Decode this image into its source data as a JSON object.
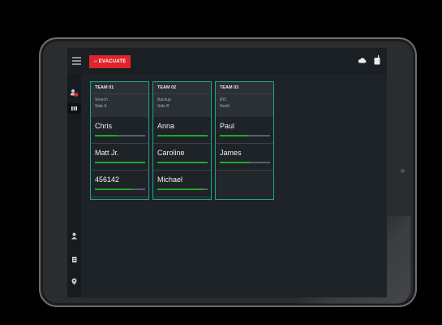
{
  "colors": {
    "accent_teal": "#1fa38a",
    "evacuate_red": "#e0242b",
    "progress_green": "#1cab2c",
    "screen_bg": "#1e2328"
  },
  "topbar": {
    "evacuate_label": "EVACUATE",
    "evacuate_prefix": "›‹",
    "menu_icon": "hamburger-icon",
    "cloud_icon": "cloud-icon",
    "radio_icon": "radio-icon"
  },
  "rail": {
    "items": [
      {
        "icon": "team-alert-icon"
      },
      {
        "icon": "columns-icon",
        "active": true
      },
      {
        "icon": "person-icon"
      },
      {
        "icon": "document-icon"
      },
      {
        "icon": "location-pin-icon"
      }
    ]
  },
  "teams": [
    {
      "name": "TEAM 01",
      "task": "Search",
      "area": "Side A",
      "members": [
        {
          "name": "Chris",
          "progress": 0.45
        },
        {
          "name": "Matt Jr.",
          "progress": 1.0
        },
        {
          "name": "456142",
          "progress": 0.72
        }
      ]
    },
    {
      "name": "TEAM 02",
      "task": "Backup",
      "area": "Side B",
      "members": [
        {
          "name": "Anna",
          "progress": 1.0
        },
        {
          "name": "Caroline",
          "progress": 1.0
        },
        {
          "name": "Michael",
          "progress": 0.9
        }
      ]
    },
    {
      "name": "TEAM 03",
      "task": "RIC",
      "area": "North",
      "members": [
        {
          "name": "Paul",
          "progress": 0.55
        },
        {
          "name": "James",
          "progress": 0.6
        }
      ]
    }
  ]
}
